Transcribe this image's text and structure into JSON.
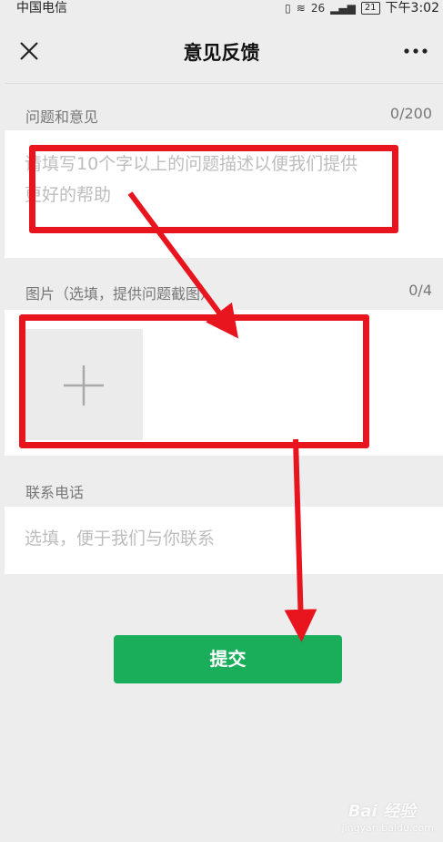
{
  "status_bar": {
    "carrier": "中国电信",
    "network": "26",
    "battery": "21",
    "time": "下午3:02"
  },
  "nav": {
    "title": "意见反馈",
    "close_icon": "close-icon",
    "more_icon": "more-icon"
  },
  "feedback": {
    "label": "问题和意见",
    "counter": "0/200",
    "placeholder_line1": "请填写10个字以上的问题描述以便我们提供",
    "placeholder_line2": "更好的帮助"
  },
  "images": {
    "label": "图片（选填，提供问题截图）",
    "counter": "0/4",
    "add_icon": "plus-icon"
  },
  "contact": {
    "label": "联系电话",
    "placeholder": "选填，便于我们与你联系"
  },
  "submit": {
    "label": "提交",
    "color": "#1aad5a"
  },
  "annotations": {
    "color": "#e8141e"
  },
  "watermark": {
    "text": "Bai 经验",
    "sub": "jingyan.baidu.com"
  }
}
